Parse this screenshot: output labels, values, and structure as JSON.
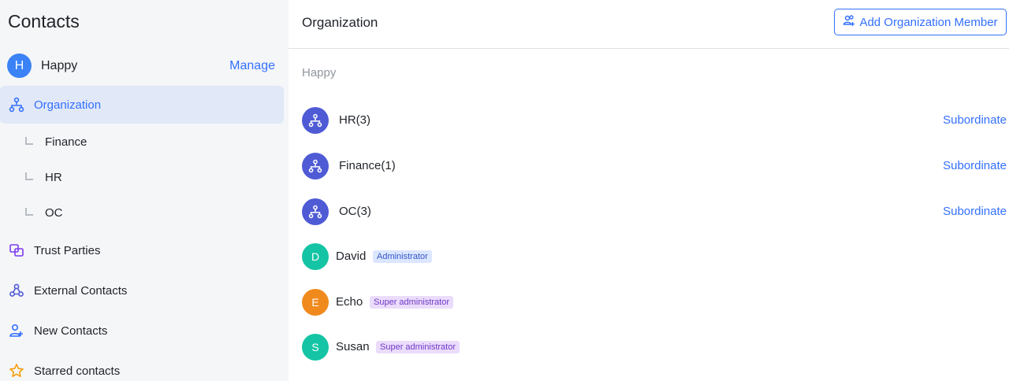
{
  "sidebar": {
    "title": "Contacts",
    "account": {
      "initial": "H",
      "name": "Happy",
      "manage_label": "Manage"
    },
    "organization": {
      "label": "Organization"
    },
    "sub_items": [
      {
        "label": "Finance"
      },
      {
        "label": "HR"
      },
      {
        "label": "OC"
      }
    ],
    "items": [
      {
        "label": "Trust Parties",
        "icon": "trust-parties-icon"
      },
      {
        "label": "External Contacts",
        "icon": "external-contacts-icon"
      },
      {
        "label": "New Contacts",
        "icon": "new-contacts-icon"
      },
      {
        "label": "Starred contacts",
        "icon": "star-icon"
      }
    ]
  },
  "main": {
    "title": "Organization",
    "add_button_label": "Add Organization Member",
    "group_label": "Happy",
    "departments": [
      {
        "name": "HR(3)",
        "action": "Subordinate"
      },
      {
        "name": "Finance(1)",
        "action": "Subordinate"
      },
      {
        "name": "OC(3)",
        "action": "Subordinate"
      }
    ],
    "members": [
      {
        "initial": "D",
        "name": "David",
        "role": "Administrator",
        "color": "#14c4a4"
      },
      {
        "initial": "E",
        "name": "Echo",
        "role": "Super administrator",
        "color": "#f08a1c"
      },
      {
        "initial": "S",
        "name": "Susan",
        "role": "Super administrator",
        "color": "#14c4a4"
      }
    ]
  },
  "colors": {
    "accent": "#3370ff",
    "dept_avatar": "#4f5bd5",
    "sidebar_bg": "#f5f6f8",
    "active_bg": "#e1e8f7"
  }
}
